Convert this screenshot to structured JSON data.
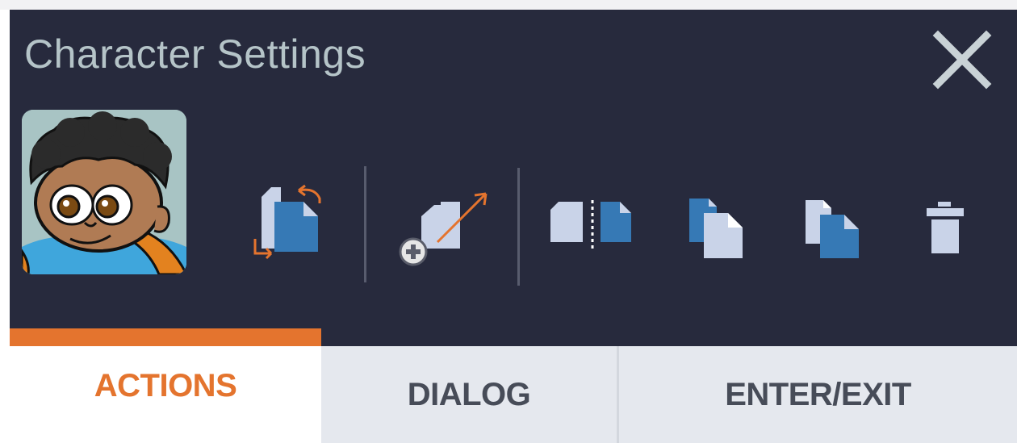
{
  "window": {
    "title": "Character Settings",
    "close_icon": "close-icon"
  },
  "avatar": {
    "icon": "character-avatar"
  },
  "toolbar": {
    "tools": [
      {
        "id": "swap",
        "icon": "swap-copy-icon"
      },
      {
        "id": "add-move",
        "icon": "add-move-icon"
      },
      {
        "id": "split",
        "icon": "split-icon"
      },
      {
        "id": "duplicate-dark",
        "icon": "duplicate-icon"
      },
      {
        "id": "duplicate-light",
        "icon": "duplicate-icon"
      },
      {
        "id": "delete",
        "icon": "trash-icon"
      }
    ]
  },
  "tabs": {
    "items": [
      {
        "label": "ACTIONS",
        "active": true
      },
      {
        "label": "DIALOG",
        "active": false
      },
      {
        "label": "ENTER/EXIT",
        "active": false
      }
    ]
  },
  "colors": {
    "panel": "#272a3d",
    "accent": "#e4742e",
    "icon_blue": "#3679b5",
    "icon_light": "#c9d3e8",
    "title": "#b5c4c8"
  }
}
